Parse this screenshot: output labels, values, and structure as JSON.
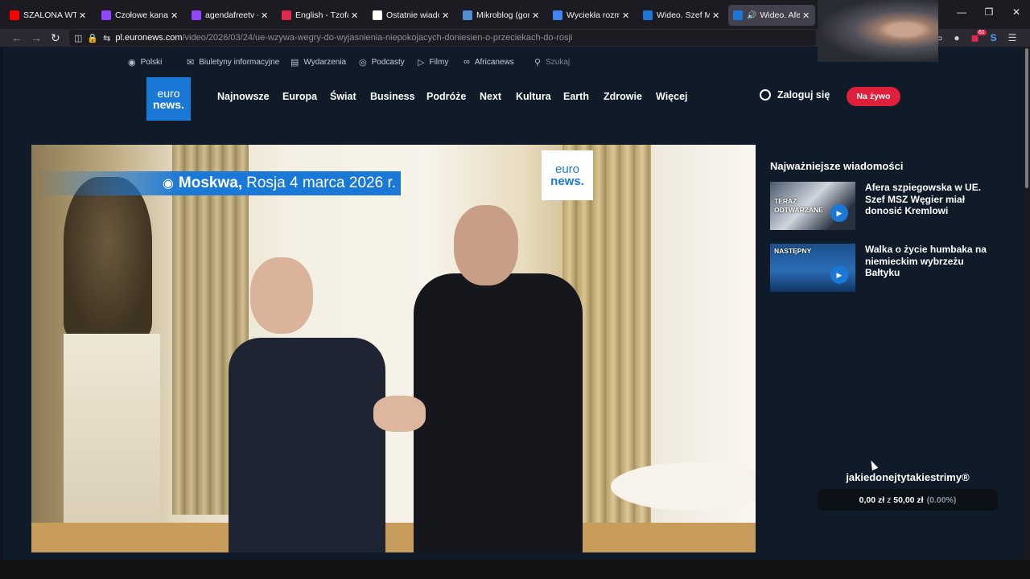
{
  "browser": {
    "tabs": [
      {
        "title": "SZALONA WTORE",
        "icon": "youtube-icon",
        "color": "#ff0000"
      },
      {
        "title": "Czołowe kanały -",
        "icon": "twitch-icon",
        "color": "#9146ff"
      },
      {
        "title": "agendafreetv - Tw",
        "icon": "twitch-icon",
        "color": "#9146ff"
      },
      {
        "title": "English - Tzofar -",
        "icon": "tzofar-icon",
        "color": "#e22850"
      },
      {
        "title": "Ostatnie wiadomo",
        "icon": "news-icon",
        "color": "#ffffff"
      },
      {
        "title": "Mikroblog (gorąc",
        "icon": "wykop-icon",
        "color": "#4e8fd6"
      },
      {
        "title": "Wyciekła rozmow",
        "icon": "google-icon",
        "color": "#4285f4"
      },
      {
        "title": "Wideo. Szef MSZ",
        "icon": "euronews-icon",
        "color": "#1a78d6"
      },
      {
        "title": "Wideo. Afera",
        "icon": "euronews-icon",
        "color": "#1a78d6",
        "active": true
      }
    ],
    "url_host": "pl.euronews.com",
    "url_path": "/video/2026/03/24/ue-wzywa-wegry-do-wyjasnienia-niepokojacych-doniesien-o-przeciekach-do-rosji",
    "extensions_badge": "61"
  },
  "site": {
    "topline": {
      "language": "Polski",
      "newsletters": "Biuletyny informacyjne",
      "events": "Wydarzenia",
      "podcasts": "Podcasty",
      "films": "Filmy",
      "africanews": "Africanews",
      "search_placeholder": "Szukaj"
    },
    "logo": {
      "line1": "euro",
      "line2": "news."
    },
    "nav": [
      "Najnowsze",
      "Europa",
      "Świat",
      "Business",
      "Podróże",
      "Next",
      "Kultura",
      "Earth",
      "Zdrowie",
      "Więcej"
    ],
    "login": "Zaloguj się",
    "live": "Na żywo"
  },
  "video": {
    "location_city": "Moskwa,",
    "location_rest": "Rosja 4 marca 2026 r.",
    "watermark": {
      "line1": "euro",
      "line2": "news."
    }
  },
  "sidebar": {
    "title": "Najważniejsze wiadomości",
    "items": [
      {
        "label": "TERAZ ODTWARZANE",
        "title": "Afera szpiegowska w UE. Szef MSZ Węgier miał donosić Kremlowi"
      },
      {
        "label": "NASTĘPNY",
        "title": "Walka o życie humbaka na niemieckim wybrzeżu Bałtyku"
      }
    ]
  },
  "tip": {
    "name": "jakiedonejtytakiestrimy®",
    "amount": "0,00 zł",
    "sep": "z",
    "goal": "50,00 zł",
    "percent": "(0.00%)"
  },
  "colors": {
    "brand_blue": "#1a78d6",
    "live_red": "#e0203a",
    "page_bg": "#0f1b29"
  }
}
